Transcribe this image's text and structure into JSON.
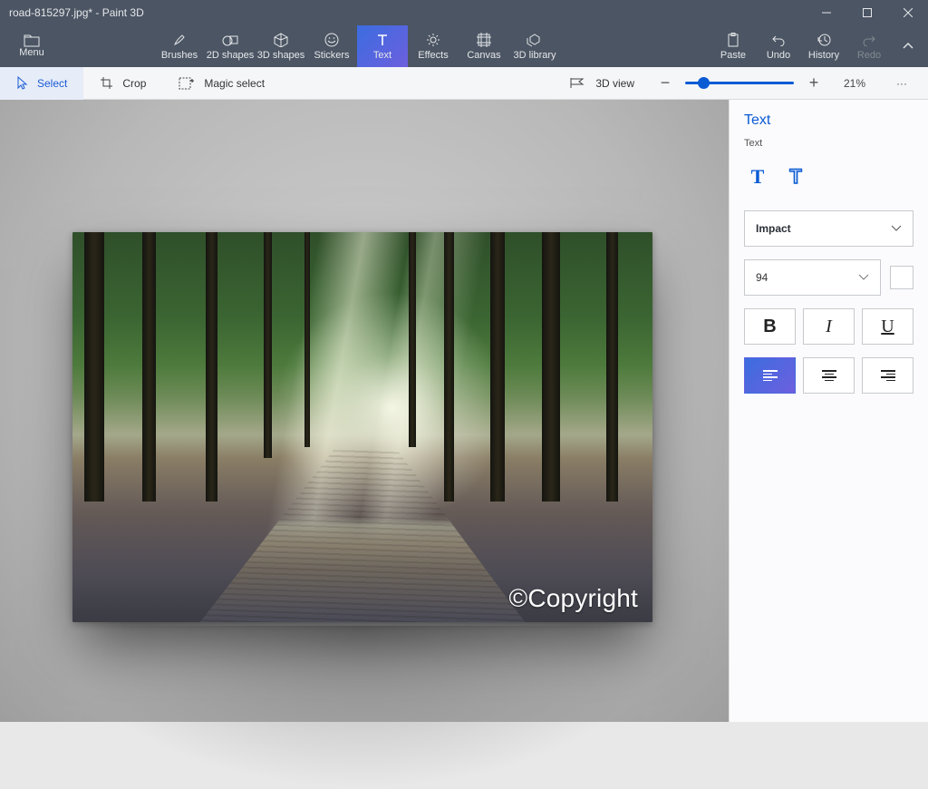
{
  "title": "road-815297.jpg* - Paint 3D",
  "menu_label": "Menu",
  "ribbon": {
    "tools": [
      {
        "label": "Brushes"
      },
      {
        "label": "2D shapes"
      },
      {
        "label": "3D shapes"
      },
      {
        "label": "Stickers"
      },
      {
        "label": "Text"
      },
      {
        "label": "Effects"
      },
      {
        "label": "Canvas"
      },
      {
        "label": "3D library"
      }
    ],
    "right": [
      {
        "label": "Paste"
      },
      {
        "label": "Undo"
      },
      {
        "label": "History"
      },
      {
        "label": "Redo"
      }
    ]
  },
  "subbar": {
    "select": "Select",
    "crop": "Crop",
    "magic": "Magic select",
    "view3d": "3D view",
    "zoom": "21%",
    "more": "···"
  },
  "canvas": {
    "watermark": "©Copyright"
  },
  "panel": {
    "heading": "Text",
    "section": "Text",
    "font": "Impact",
    "size": "94",
    "bold": "B",
    "italic": "I",
    "under": "U",
    "color": "#ffffff"
  }
}
